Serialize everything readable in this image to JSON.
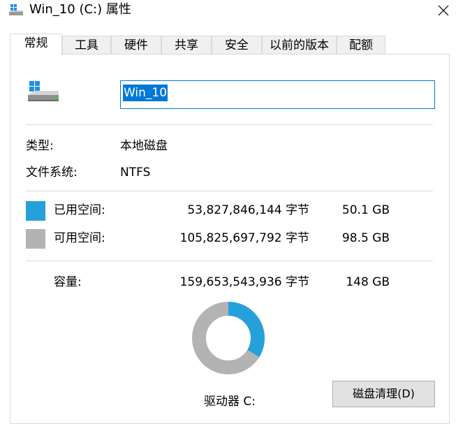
{
  "window": {
    "title": "Win_10 (C:) 属性"
  },
  "tabs": [
    {
      "label": "常规",
      "active": true
    },
    {
      "label": "工具",
      "active": false
    },
    {
      "label": "硬件",
      "active": false
    },
    {
      "label": "共享",
      "active": false
    },
    {
      "label": "安全",
      "active": false
    },
    {
      "label": "以前的版本",
      "active": false
    },
    {
      "label": "配额",
      "active": false
    }
  ],
  "general": {
    "volume_name": "Win_10",
    "type_label": "类型:",
    "type_value": "本地磁盘",
    "fs_label": "文件系统:",
    "fs_value": "NTFS",
    "used": {
      "label": "已用空间:",
      "bytes": "53,827,846,144 字节",
      "size": "50.1 GB",
      "color": "#26a0da"
    },
    "free": {
      "label": "可用空间:",
      "bytes": "105,825,697,792 字节",
      "size": "98.5 GB",
      "color": "#b3b3b3"
    },
    "capacity": {
      "label": "容量:",
      "bytes": "159,653,543,936 字节",
      "size": "148 GB"
    },
    "used_fraction": 0.337,
    "drive_label": "驱动器 C:",
    "cleanup_button": "磁盘清理(D)"
  },
  "icons": {
    "title": "drive-icon",
    "close": "close-icon",
    "drive": "windows-drive-icon"
  }
}
